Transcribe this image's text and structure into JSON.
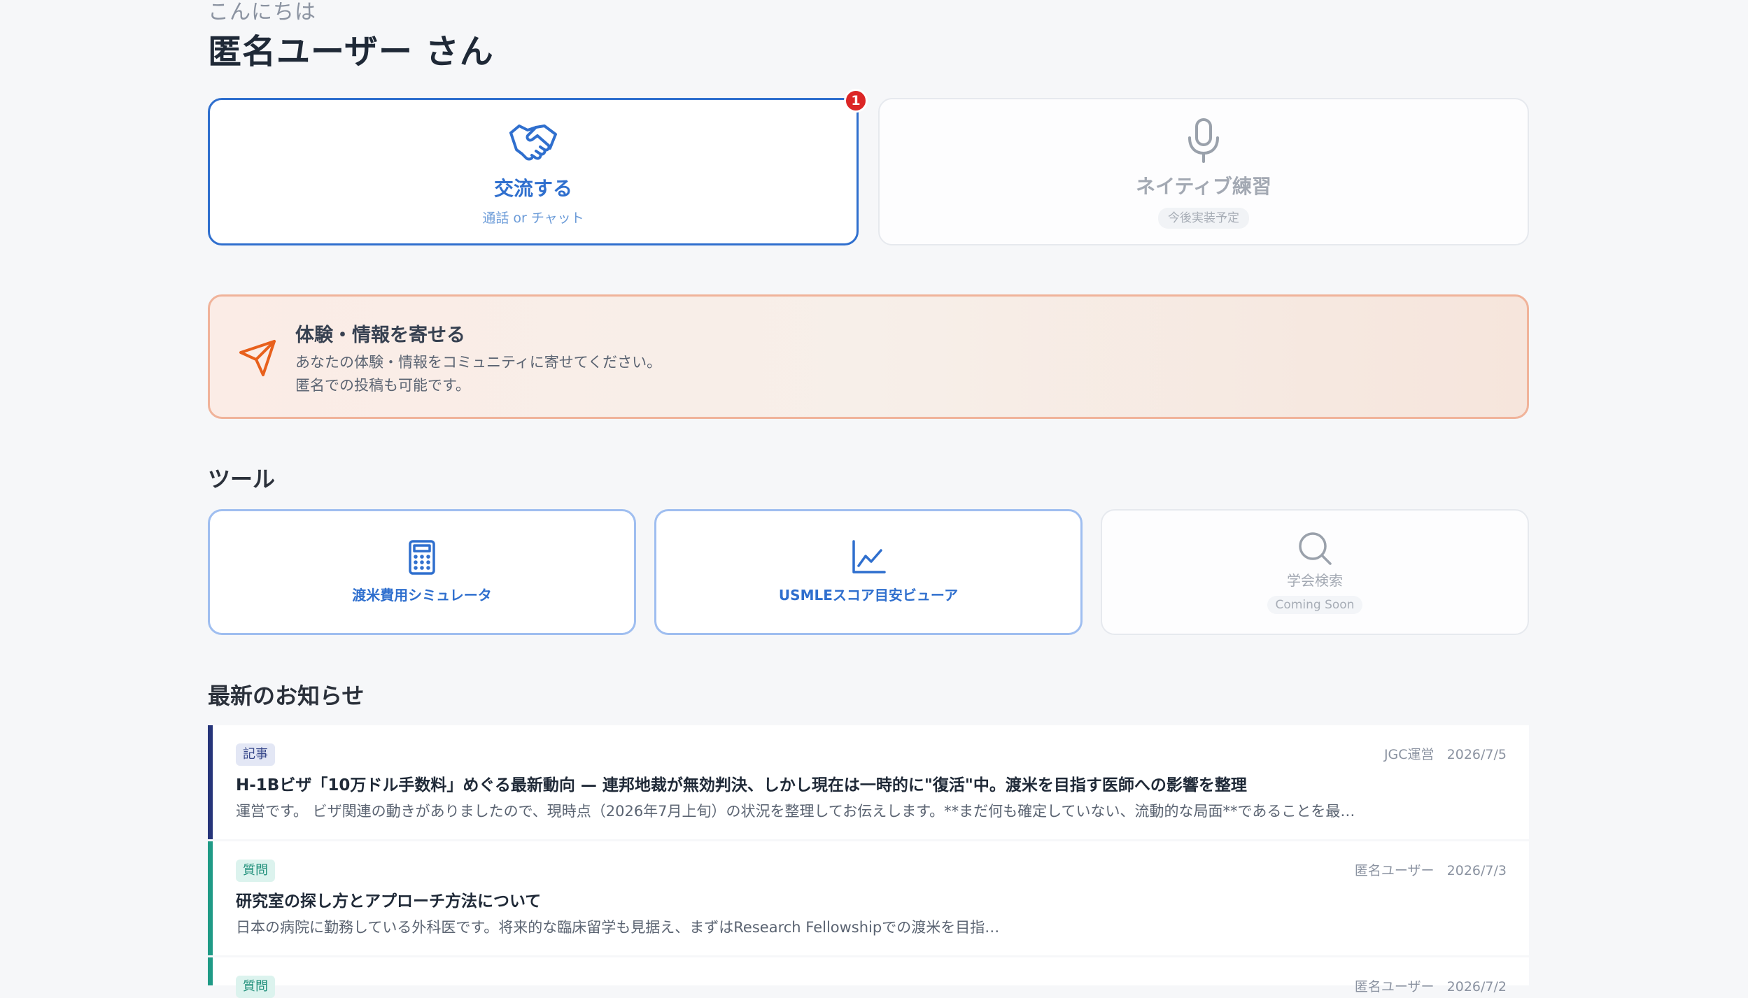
{
  "header": {
    "greeting": "こんにちは",
    "username": "匿名ユーザー さん"
  },
  "actions": {
    "exchange": {
      "title": "交流する",
      "subtitle": "通話 or チャット",
      "badge": "1",
      "icon": "handshake-icon",
      "color": "#2f6fce"
    },
    "native": {
      "title": "ネイティブ練習",
      "subtitle": "今後実装予定",
      "icon": "microphone-icon",
      "state": "disabled"
    }
  },
  "contribute": {
    "title": "体験・情報を寄せる",
    "line1": "あなたの体験・情報をコミュニティに寄せてください。",
    "line2": "匿名での投稿も可能です。",
    "icon": "send-icon",
    "accent": "#e8601c"
  },
  "tools": {
    "section_title": "ツール",
    "items": [
      {
        "label": "渡米費用シミュレータ",
        "icon": "calculator-icon",
        "state": "enabled"
      },
      {
        "label": "USMLEスコア目安ビューア",
        "icon": "line-chart-icon",
        "state": "enabled"
      },
      {
        "label": "学会検索",
        "sub": "Coming Soon",
        "icon": "search-icon",
        "state": "disabled"
      }
    ]
  },
  "news": {
    "section_title": "最新のお知らせ",
    "items": [
      {
        "tag": "記事",
        "author": "JGC運営",
        "date": "2026/7/5",
        "title": "H-1Bビザ「10万ドル手数料」めぐる最新動向 — 連邦地裁が無効判決、しかし現在は一時的に\"復活\"中。渡米を目指す医師への影響を整理",
        "excerpt": "運営です。 ビザ関連の動きがありましたので、現時点（2026年7月上旬）の状況を整理してお伝えします。**まだ何も確定していない、流動的な局面**であることを最…",
        "accent": "#26357a"
      },
      {
        "tag": "質問",
        "author": "匿名ユーザー",
        "date": "2026/7/3",
        "title": "研究室の探し方とアプローチ方法について",
        "excerpt": "日本の病院に勤務している外科医です。将来的な臨床留学も見据え、まずはResearch Fellowshipでの渡米を目指…",
        "accent": "#1f9a86"
      },
      {
        "tag": "質問",
        "author": "匿名ユーザー",
        "date": "2026/7/2",
        "title": "",
        "excerpt": "",
        "accent": "#1f9a86"
      }
    ]
  }
}
